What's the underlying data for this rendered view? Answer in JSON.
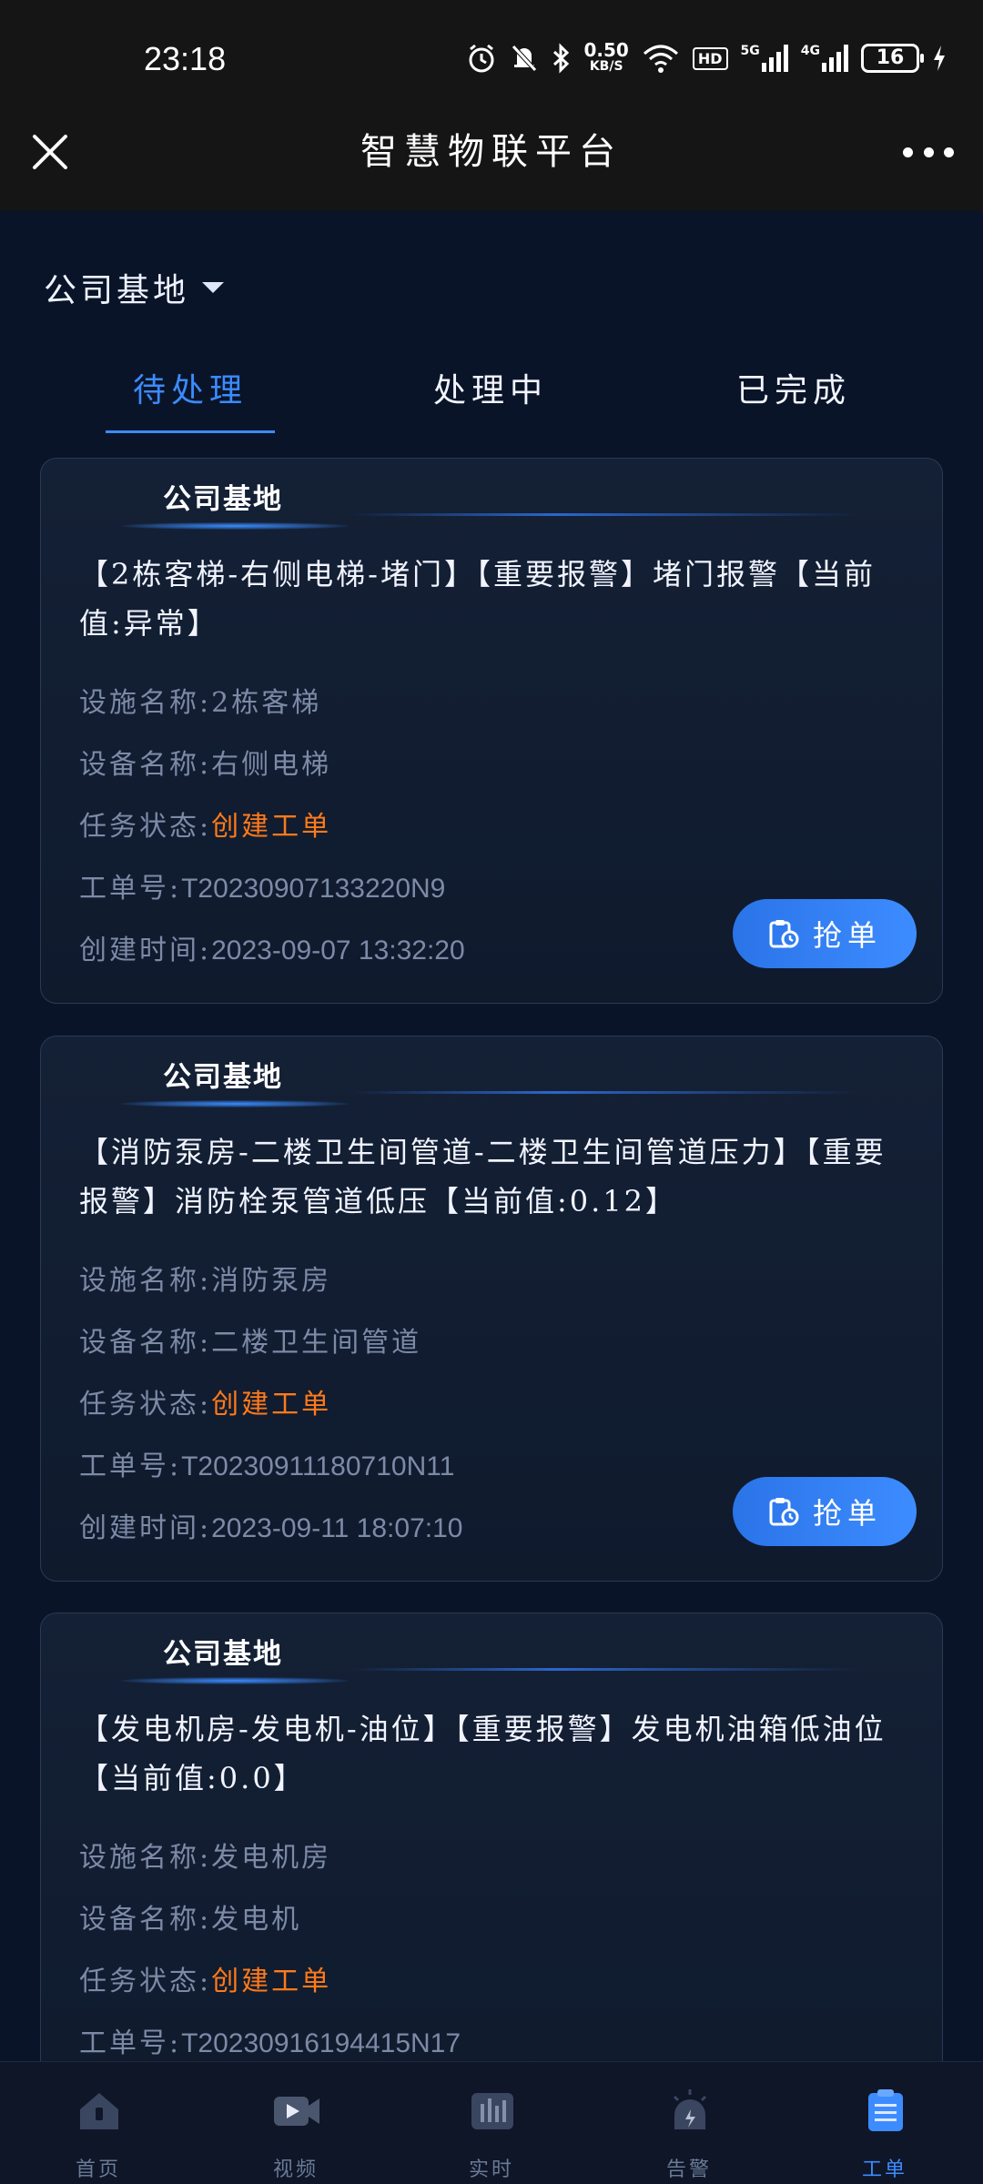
{
  "status_bar": {
    "time": "23:18",
    "net_speed": "0.50",
    "net_unit": "KB/S",
    "hd": "HD",
    "sig1": "5G",
    "sig2": "4G",
    "battery": "16"
  },
  "header": {
    "title": "智慧物联平台"
  },
  "location": {
    "label": "公司基地"
  },
  "tabs": [
    {
      "label": "待处理"
    },
    {
      "label": "处理中"
    },
    {
      "label": "已完成"
    }
  ],
  "field_labels": {
    "facility": "设施名称:",
    "device": "设备名称:",
    "status": "任务状态:",
    "order_no": "工单号:",
    "created": "创建时间:"
  },
  "grab_button": "抢单",
  "cards": [
    {
      "site": "公司基地",
      "desc": "【2栋客梯-右侧电梯-堵门】【重要报警】堵门报警【当前值:异常】",
      "facility": "2栋客梯",
      "device": "右侧电梯",
      "status": "创建工单",
      "order_no": "T20230907133220N9",
      "created": "2023-09-07 13:32:20"
    },
    {
      "site": "公司基地",
      "desc": "【消防泵房-二楼卫生间管道-二楼卫生间管道压力】【重要报警】消防栓泵管道低压【当前值:0.12】",
      "facility": "消防泵房",
      "device": "二楼卫生间管道",
      "status": "创建工单",
      "order_no": "T20230911180710N11",
      "created": "2023-09-11 18:07:10"
    },
    {
      "site": "公司基地",
      "desc": "【发电机房-发电机-油位】【重要报警】发电机油箱低油位【当前值:0.0】",
      "facility": "发电机房",
      "device": "发电机",
      "status": "创建工单",
      "order_no": "T20230916194415N17",
      "created": ""
    }
  ],
  "bottom_nav": [
    {
      "label": "首页",
      "icon": "home-icon"
    },
    {
      "label": "视频",
      "icon": "video-icon"
    },
    {
      "label": "实时",
      "icon": "realtime-chart-icon"
    },
    {
      "label": "告警",
      "icon": "alarm-icon"
    },
    {
      "label": "工单",
      "icon": "work-order-icon"
    }
  ],
  "colors": {
    "background": "#0a1428",
    "accent": "#3d8cff",
    "status": "#ff7a1a",
    "muted": "#7c8aa6"
  }
}
